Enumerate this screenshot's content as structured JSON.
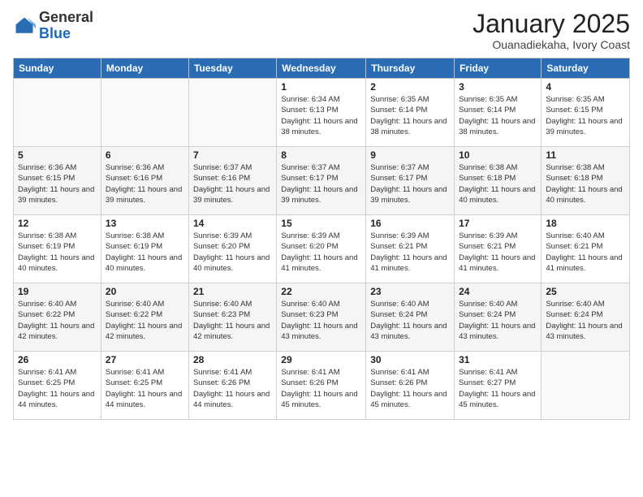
{
  "logo": {
    "general": "General",
    "blue": "Blue"
  },
  "header": {
    "month": "January 2025",
    "location": "Ouanadiekaha, Ivory Coast"
  },
  "weekdays": [
    "Sunday",
    "Monday",
    "Tuesday",
    "Wednesday",
    "Thursday",
    "Friday",
    "Saturday"
  ],
  "weeks": [
    [
      {
        "day": "",
        "info": ""
      },
      {
        "day": "",
        "info": ""
      },
      {
        "day": "",
        "info": ""
      },
      {
        "day": "1",
        "info": "Sunrise: 6:34 AM\nSunset: 6:13 PM\nDaylight: 11 hours and 38 minutes."
      },
      {
        "day": "2",
        "info": "Sunrise: 6:35 AM\nSunset: 6:14 PM\nDaylight: 11 hours and 38 minutes."
      },
      {
        "day": "3",
        "info": "Sunrise: 6:35 AM\nSunset: 6:14 PM\nDaylight: 11 hours and 38 minutes."
      },
      {
        "day": "4",
        "info": "Sunrise: 6:35 AM\nSunset: 6:15 PM\nDaylight: 11 hours and 39 minutes."
      }
    ],
    [
      {
        "day": "5",
        "info": "Sunrise: 6:36 AM\nSunset: 6:15 PM\nDaylight: 11 hours and 39 minutes."
      },
      {
        "day": "6",
        "info": "Sunrise: 6:36 AM\nSunset: 6:16 PM\nDaylight: 11 hours and 39 minutes."
      },
      {
        "day": "7",
        "info": "Sunrise: 6:37 AM\nSunset: 6:16 PM\nDaylight: 11 hours and 39 minutes."
      },
      {
        "day": "8",
        "info": "Sunrise: 6:37 AM\nSunset: 6:17 PM\nDaylight: 11 hours and 39 minutes."
      },
      {
        "day": "9",
        "info": "Sunrise: 6:37 AM\nSunset: 6:17 PM\nDaylight: 11 hours and 39 minutes."
      },
      {
        "day": "10",
        "info": "Sunrise: 6:38 AM\nSunset: 6:18 PM\nDaylight: 11 hours and 40 minutes."
      },
      {
        "day": "11",
        "info": "Sunrise: 6:38 AM\nSunset: 6:18 PM\nDaylight: 11 hours and 40 minutes."
      }
    ],
    [
      {
        "day": "12",
        "info": "Sunrise: 6:38 AM\nSunset: 6:19 PM\nDaylight: 11 hours and 40 minutes."
      },
      {
        "day": "13",
        "info": "Sunrise: 6:38 AM\nSunset: 6:19 PM\nDaylight: 11 hours and 40 minutes."
      },
      {
        "day": "14",
        "info": "Sunrise: 6:39 AM\nSunset: 6:20 PM\nDaylight: 11 hours and 40 minutes."
      },
      {
        "day": "15",
        "info": "Sunrise: 6:39 AM\nSunset: 6:20 PM\nDaylight: 11 hours and 41 minutes."
      },
      {
        "day": "16",
        "info": "Sunrise: 6:39 AM\nSunset: 6:21 PM\nDaylight: 11 hours and 41 minutes."
      },
      {
        "day": "17",
        "info": "Sunrise: 6:39 AM\nSunset: 6:21 PM\nDaylight: 11 hours and 41 minutes."
      },
      {
        "day": "18",
        "info": "Sunrise: 6:40 AM\nSunset: 6:21 PM\nDaylight: 11 hours and 41 minutes."
      }
    ],
    [
      {
        "day": "19",
        "info": "Sunrise: 6:40 AM\nSunset: 6:22 PM\nDaylight: 11 hours and 42 minutes."
      },
      {
        "day": "20",
        "info": "Sunrise: 6:40 AM\nSunset: 6:22 PM\nDaylight: 11 hours and 42 minutes."
      },
      {
        "day": "21",
        "info": "Sunrise: 6:40 AM\nSunset: 6:23 PM\nDaylight: 11 hours and 42 minutes."
      },
      {
        "day": "22",
        "info": "Sunrise: 6:40 AM\nSunset: 6:23 PM\nDaylight: 11 hours and 43 minutes."
      },
      {
        "day": "23",
        "info": "Sunrise: 6:40 AM\nSunset: 6:24 PM\nDaylight: 11 hours and 43 minutes."
      },
      {
        "day": "24",
        "info": "Sunrise: 6:40 AM\nSunset: 6:24 PM\nDaylight: 11 hours and 43 minutes."
      },
      {
        "day": "25",
        "info": "Sunrise: 6:40 AM\nSunset: 6:24 PM\nDaylight: 11 hours and 43 minutes."
      }
    ],
    [
      {
        "day": "26",
        "info": "Sunrise: 6:41 AM\nSunset: 6:25 PM\nDaylight: 11 hours and 44 minutes."
      },
      {
        "day": "27",
        "info": "Sunrise: 6:41 AM\nSunset: 6:25 PM\nDaylight: 11 hours and 44 minutes."
      },
      {
        "day": "28",
        "info": "Sunrise: 6:41 AM\nSunset: 6:26 PM\nDaylight: 11 hours and 44 minutes."
      },
      {
        "day": "29",
        "info": "Sunrise: 6:41 AM\nSunset: 6:26 PM\nDaylight: 11 hours and 45 minutes."
      },
      {
        "day": "30",
        "info": "Sunrise: 6:41 AM\nSunset: 6:26 PM\nDaylight: 11 hours and 45 minutes."
      },
      {
        "day": "31",
        "info": "Sunrise: 6:41 AM\nSunset: 6:27 PM\nDaylight: 11 hours and 45 minutes."
      },
      {
        "day": "",
        "info": ""
      }
    ]
  ]
}
